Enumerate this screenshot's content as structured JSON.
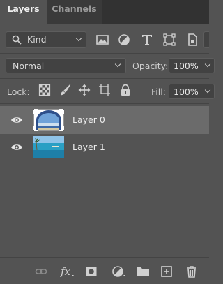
{
  "tabs": [
    {
      "label": "Layers",
      "active": true
    },
    {
      "label": "Channels",
      "active": false
    }
  ],
  "filter": {
    "kind_label": "Kind",
    "icons": [
      "pixel-filter-icon",
      "adjustment-filter-icon",
      "type-filter-icon",
      "shape-filter-icon",
      "smart-object-filter-icon"
    ]
  },
  "blend": {
    "mode": "Normal",
    "opacity_label": "Opacity:",
    "opacity_value": "100%"
  },
  "lock": {
    "label": "Lock:",
    "icons": [
      "lock-transparent-pixels-icon",
      "lock-image-pixels-icon",
      "lock-position-icon",
      "lock-artboard-icon",
      "lock-all-icon"
    ],
    "fill_label": "Fill:",
    "fill_value": "100%"
  },
  "layers": [
    {
      "name": "Layer 0",
      "selected": true,
      "visible": true
    },
    {
      "name": "Layer 1",
      "selected": false,
      "visible": true
    }
  ],
  "footer_icons": [
    "link-layers-icon",
    "layer-style-fx-icon",
    "add-mask-icon",
    "adjustment-layer-icon",
    "group-folder-icon",
    "new-layer-icon",
    "delete-layer-icon"
  ],
  "colors": {
    "panel": "#535353",
    "selected_row": "#6b6b6b",
    "tab_bar": "#323232"
  }
}
